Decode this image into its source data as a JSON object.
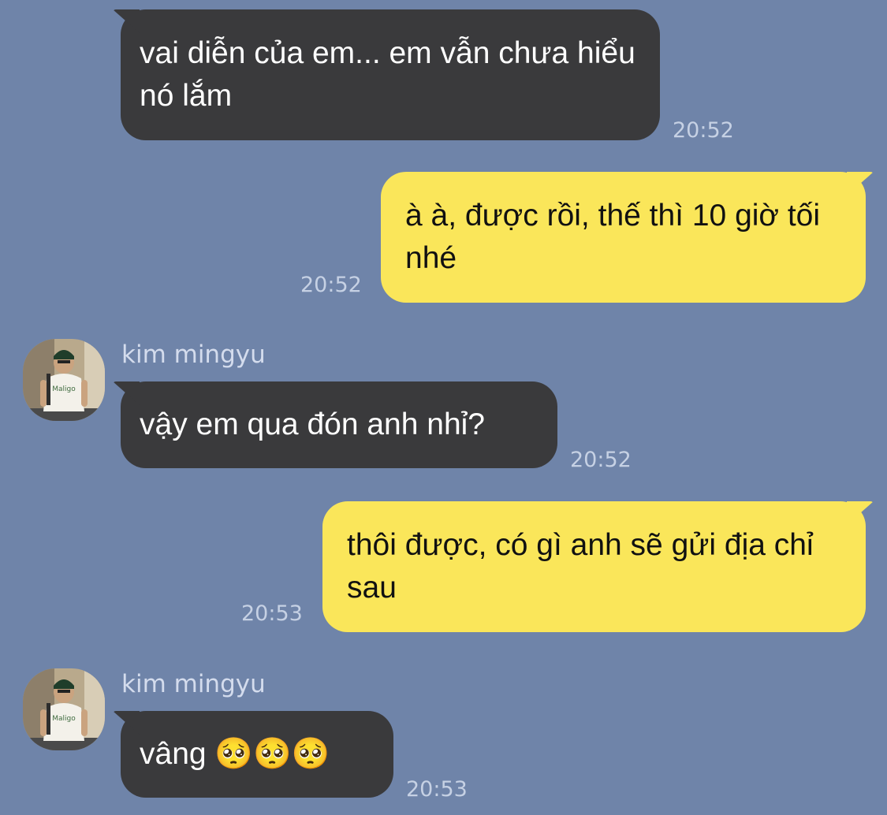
{
  "messages": [
    {
      "direction": "incoming",
      "text": "vai diễn của em... em vẫn chưa hiểu nó lắm",
      "time": "20:52"
    },
    {
      "direction": "outgoing",
      "text": "à à, được rồi, thế thì 10 giờ tối nhé",
      "time": "20:52"
    },
    {
      "direction": "incoming",
      "sender": "kim mingyu",
      "avatar": "avatar-icon",
      "text": "vậy em qua đón anh nhỉ?",
      "time": "20:52"
    },
    {
      "direction": "outgoing",
      "text": "thôi được, có gì anh sẽ gửi địa chỉ sau",
      "time": "20:53"
    },
    {
      "direction": "incoming",
      "sender": "kim mingyu",
      "avatar": "avatar-icon",
      "text": "vâng 🥺🥺🥺",
      "time": "20:53"
    }
  ],
  "colors": {
    "background": "#6f84a9",
    "incoming_bubble": "#3a3a3c",
    "outgoing_bubble": "#fae65a",
    "timestamp": "#c6d1e4"
  }
}
